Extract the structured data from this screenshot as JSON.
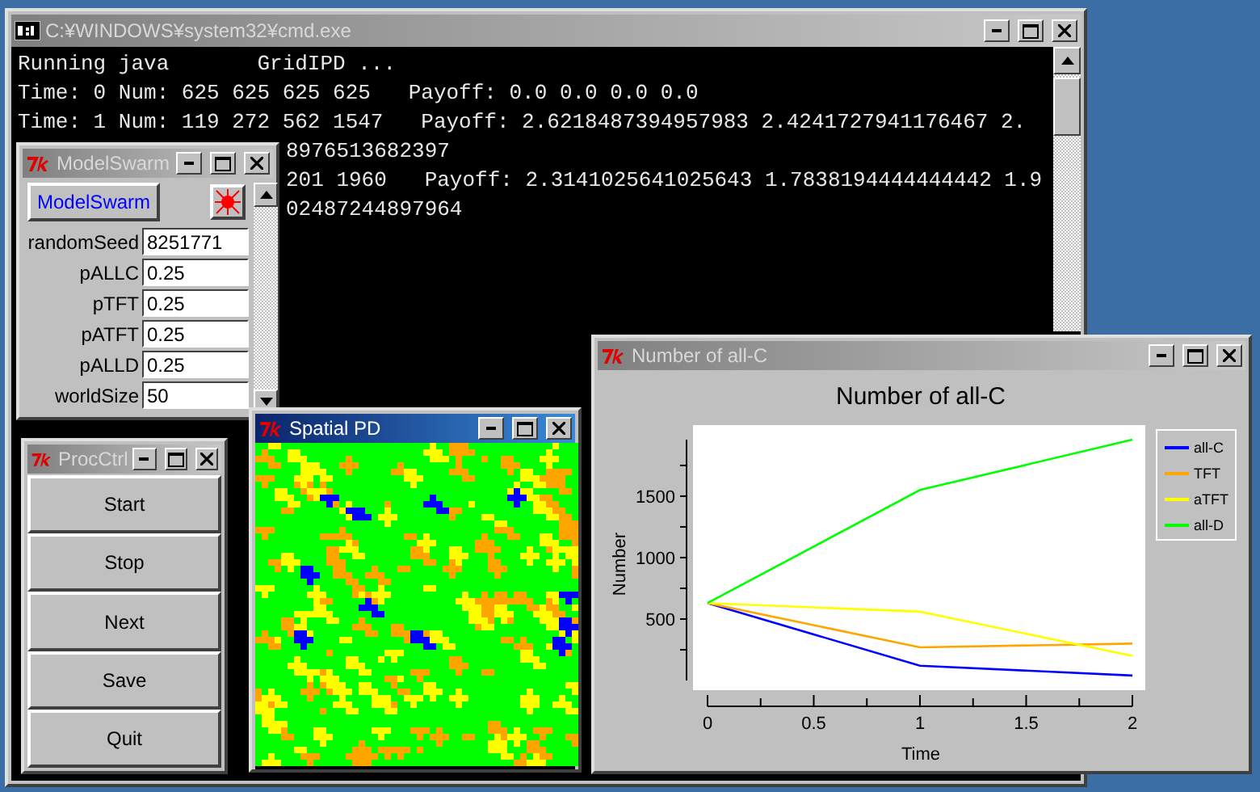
{
  "console_window": {
    "title": "C:¥WINDOWS¥system32¥cmd.exe",
    "active": false,
    "lines": [
      "Running java       GridIPD ...",
      "Time: 0 Num: 625 625 625 625   Payoff: 0.0 0.0 0.0 0.0",
      "Time: 1 Num: 119 272 562 1547   Payoff: 2.6218487394957983 2.4241727941176467 2.",
      "8976513682397",
      "201 1960   Payoff: 2.3141025641025643 1.7838194444444442 1.9",
      "02487244897964"
    ]
  },
  "model_window": {
    "title": "ModelSwarm",
    "active": false,
    "button": "ModelSwarm",
    "fields": [
      {
        "label": "randomSeed",
        "value": "8251771"
      },
      {
        "label": "pALLC",
        "value": "0.25"
      },
      {
        "label": "pTFT",
        "value": "0.25"
      },
      {
        "label": "pATFT",
        "value": "0.25"
      },
      {
        "label": "pALLD",
        "value": "0.25"
      },
      {
        "label": "worldSize",
        "value": "50"
      }
    ]
  },
  "control_window": {
    "title": "ProcCtrl",
    "active": false,
    "buttons": [
      "Start",
      "Stop",
      "Next",
      "Save",
      "Quit"
    ]
  },
  "grid_window": {
    "title": "Spatial PD",
    "active": true
  },
  "chart_window": {
    "title": "Number of all-C",
    "active": false,
    "chart_data": {
      "type": "line",
      "title": "Number of all-C",
      "xlabel": "Time",
      "ylabel": "Number",
      "x": [
        0,
        1,
        2
      ],
      "series": [
        {
          "name": "all-C",
          "color": "#0000ff",
          "values": [
            630,
            120,
            40
          ]
        },
        {
          "name": "TFT",
          "color": "#ffa500",
          "values": [
            630,
            270,
            300
          ]
        },
        {
          "name": "aTFT",
          "color": "#ffff00",
          "values": [
            630,
            560,
            200
          ]
        },
        {
          "name": "all-D",
          "color": "#00ff00",
          "values": [
            630,
            1550,
            1960
          ]
        }
      ],
      "legend": "right",
      "xlim": [
        0,
        2
      ],
      "ylim": [
        0,
        1960
      ],
      "xticks": [
        0,
        0.5,
        1,
        1.5,
        2
      ],
      "yticks": [
        500,
        1000,
        1500
      ]
    }
  }
}
